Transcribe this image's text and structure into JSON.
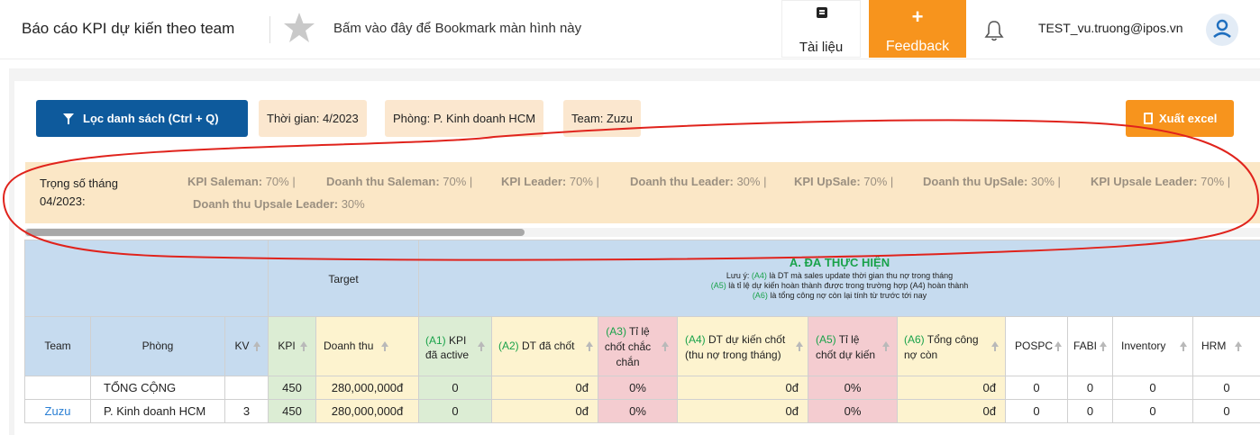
{
  "header": {
    "title": "Báo cáo KPI dự kiến theo team",
    "bookmark_text": "Bấm vào đây để Bookmark màn hình này",
    "docs_label": "Tài liệu",
    "feedback_plus": "+",
    "feedback_label": "Feedback",
    "user_email": "TEST_vu.truong@ipos.vn"
  },
  "toolbar": {
    "filter_label": "Lọc danh sách (Ctrl + Q)",
    "chip_time": "Thời gian: 4/2023",
    "chip_dept": "Phòng: P. Kinh doanh HCM",
    "chip_team": "Team: Zuzu",
    "export_label": "Xuất excel"
  },
  "weights": {
    "title": "Trọng số tháng 04/2023:",
    "items": [
      {
        "label": "KPI Saleman:",
        "value": " 70% |"
      },
      {
        "label": "Doanh thu Saleman:",
        "value": " 70% |"
      },
      {
        "label": "KPI Leader:",
        "value": " 70% |"
      },
      {
        "label": "Doanh thu Leader:",
        "value": " 30% |"
      },
      {
        "label": "KPI UpSale:",
        "value": " 70% |"
      },
      {
        "label": "Doanh thu UpSale:",
        "value": " 30% |"
      },
      {
        "label": "KPI Upsale Leader:",
        "value": " 70% |"
      },
      {
        "label": "Doanh thu Upsale Leader:",
        "value": " 30%"
      }
    ]
  },
  "table": {
    "group_target": "Target",
    "group_done": "A. ĐÃ THỰC HIỆN",
    "note": {
      "l1_pre": "Lưu ý: ",
      "l1_tag": "(A4)",
      "l1_post": " là DT mà sales update thời gian thu nợ trong tháng",
      "l2_tag": "(A5)",
      "l2_post": " là tỉ lệ dự kiến hoàn thành được trong trường hợp (A4) hoàn thành",
      "l3_tag": "(A6)",
      "l3_post": " là tổng công nợ còn lại tính từ trước tới nay"
    },
    "columns": {
      "team": "Team",
      "phong": "Phòng",
      "kv": "KV",
      "kpi": "KPI",
      "doanhthu": "Doanh thu",
      "a1_tag": "(A1)",
      "a1_text": " KPI đã active",
      "a2_tag": "(A2)",
      "a2_text": " DT đã chốt",
      "a3_tag": "(A3)",
      "a3_text": " Tỉ lệ chốt chắc chắn",
      "a4_tag": "(A4)",
      "a4_text": " DT dự kiến chốt (thu nợ trong tháng)",
      "a5_tag": "(A5)",
      "a5_text": " Tỉ lệ chốt dự kiến",
      "a6_tag": "(A6)",
      "a6_text": " Tổng công nợ còn",
      "pospc": "POSPC",
      "fabi": "FABI",
      "inventory": "Inventory",
      "hrm": "HRM"
    },
    "rows": [
      {
        "team": "",
        "phong": "TỔNG CỘNG",
        "kv": "",
        "kpi": "450",
        "doanhthu": "280,000,000đ",
        "a1": "0",
        "a2": "0đ",
        "a3": "0%",
        "a4": "0đ",
        "a5": "0%",
        "a6": "0đ",
        "pospc": "0",
        "fabi": "0",
        "inventory": "0",
        "hrm": "0"
      },
      {
        "team": "Zuzu",
        "phong": "P. Kinh doanh HCM",
        "kv": "3",
        "kpi": "450",
        "doanhthu": "280,000,000đ",
        "a1": "0",
        "a2": "0đ",
        "a3": "0%",
        "a4": "0đ",
        "a5": "0%",
        "a6": "0đ",
        "pospc": "0",
        "fabi": "0",
        "inventory": "0",
        "hrm": "0"
      }
    ]
  },
  "colors": {
    "brand_blue": "#0e5a9c",
    "accent_orange": "#f7941d",
    "chip_bg": "#fbe7cf",
    "header_blue": "#c6dbef",
    "tag_green": "#19a24a",
    "annotation_red": "#e0231c"
  }
}
